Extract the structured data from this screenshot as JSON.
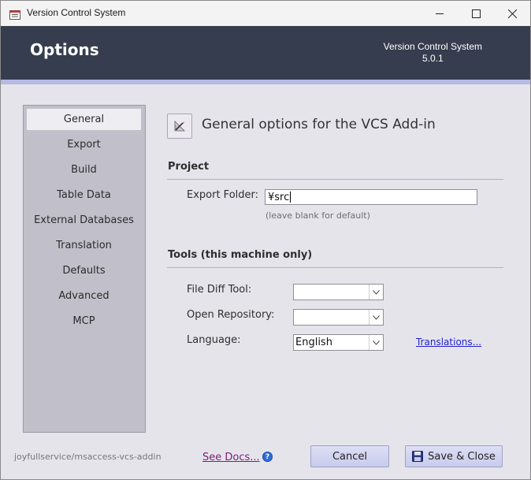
{
  "window": {
    "title": "Version Control System"
  },
  "header": {
    "title": "Options",
    "app_name": "Version Control System",
    "version": "5.0.1"
  },
  "sidebar": {
    "items": [
      {
        "label": "General",
        "active": true
      },
      {
        "label": "Export"
      },
      {
        "label": "Build"
      },
      {
        "label": "Table Data"
      },
      {
        "label": "External Databases"
      },
      {
        "label": "Translation"
      },
      {
        "label": "Defaults"
      },
      {
        "label": "Advanced"
      },
      {
        "label": "MCP"
      }
    ]
  },
  "main": {
    "section_title": "General options for the VCS Add-in",
    "section_icon": "pencil-ruler-icon",
    "project": {
      "title": "Project",
      "export_folder_label": "Export Folder:",
      "export_folder_value": "¥src",
      "export_folder_hint": "(leave blank for default)"
    },
    "tools": {
      "title": "Tools (this machine only)",
      "file_diff_label": "File Diff Tool:",
      "file_diff_value": "",
      "open_repo_label": "Open Repository:",
      "open_repo_value": "",
      "language_label": "Language:",
      "language_value": "English",
      "translations_link": "Translations..."
    }
  },
  "footer": {
    "repo": "joyfullservice/msaccess-vcs-addin",
    "see_docs": "See Docs...",
    "help_icon": "help-icon",
    "cancel_label": "Cancel",
    "save_label": "Save & Close",
    "save_icon": "floppy-disk-icon"
  },
  "colors": {
    "header_bg": "#363d4e",
    "header_accent": "#b5b9e4",
    "window_bg": "#e5e4eb",
    "sidebar_bg": "#c1c0ca",
    "button_bg": "#c8cbeb",
    "link": "#1f1fd0"
  }
}
